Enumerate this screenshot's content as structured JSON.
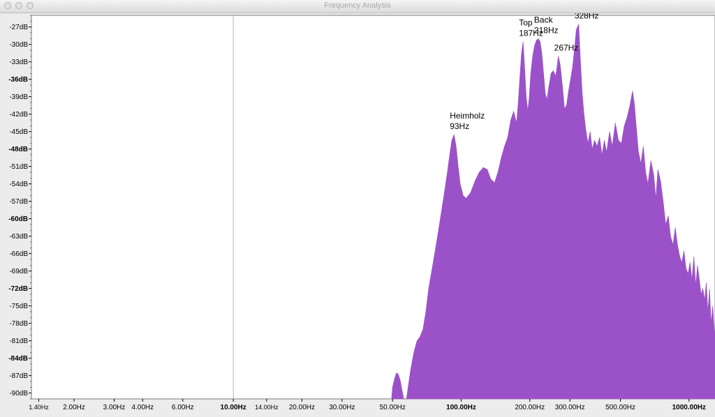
{
  "window": {
    "title": "Frequency Analysis"
  },
  "colors": {
    "spectrum_fill": "#9b52c9",
    "plot_background": "#ffffff",
    "window_background": "#ececec",
    "cursor_line": "#b4b4b4"
  },
  "chart_data": {
    "type": "area",
    "x_scale": "log",
    "y_unit": "dB",
    "xlim": [
      1.3,
      1300
    ],
    "ylim": [
      -91,
      -25
    ],
    "y_ticks": [
      {
        "value": -27,
        "label": "-27dB",
        "bold": false
      },
      {
        "value": -30,
        "label": "-30dB",
        "bold": false
      },
      {
        "value": -33,
        "label": "-33dB",
        "bold": false
      },
      {
        "value": -36,
        "label": "-36dB",
        "bold": true
      },
      {
        "value": -39,
        "label": "-39dB",
        "bold": false
      },
      {
        "value": -42,
        "label": "-42dB",
        "bold": false
      },
      {
        "value": -45,
        "label": "-45dB",
        "bold": false
      },
      {
        "value": -48,
        "label": "-48dB",
        "bold": true
      },
      {
        "value": -51,
        "label": "-51dB",
        "bold": false
      },
      {
        "value": -54,
        "label": "-54dB",
        "bold": false
      },
      {
        "value": -57,
        "label": "-57dB",
        "bold": false
      },
      {
        "value": -60,
        "label": "-60dB",
        "bold": true
      },
      {
        "value": -63,
        "label": "-63dB",
        "bold": false
      },
      {
        "value": -66,
        "label": "-66dB",
        "bold": false
      },
      {
        "value": -69,
        "label": "-69dB",
        "bold": false
      },
      {
        "value": -72,
        "label": "-72dB",
        "bold": true
      },
      {
        "value": -75,
        "label": "-75dB",
        "bold": false
      },
      {
        "value": -78,
        "label": "-78dB",
        "bold": false
      },
      {
        "value": -81,
        "label": "-81dB",
        "bold": false
      },
      {
        "value": -84,
        "label": "-84dB",
        "bold": true
      },
      {
        "value": -87,
        "label": "-87dB",
        "bold": false
      },
      {
        "value": -90,
        "label": "-90dB",
        "bold": false
      }
    ],
    "x_ticks": [
      {
        "value": 1.4,
        "label": "1.40Hz",
        "bold": false,
        "small": true
      },
      {
        "value": 2,
        "label": "2.00Hz",
        "bold": false,
        "small": false
      },
      {
        "value": 3,
        "label": "3.00Hz",
        "bold": false,
        "small": false
      },
      {
        "value": 4,
        "label": "4.00Hz",
        "bold": false,
        "small": false
      },
      {
        "value": 6,
        "label": "6.00Hz",
        "bold": false,
        "small": false
      },
      {
        "value": 10,
        "label": "10.00Hz",
        "bold": true,
        "small": false
      },
      {
        "value": 14,
        "label": "14.00Hz",
        "bold": false,
        "small": true
      },
      {
        "value": 20,
        "label": "20.00Hz",
        "bold": false,
        "small": false
      },
      {
        "value": 30,
        "label": "30.00Hz",
        "bold": false,
        "small": false
      },
      {
        "value": 50,
        "label": "50.00Hz",
        "bold": false,
        "small": false
      },
      {
        "value": 100,
        "label": "100.00Hz",
        "bold": true,
        "small": false
      },
      {
        "value": 200,
        "label": "200.00Hz",
        "bold": false,
        "small": false
      },
      {
        "value": 300,
        "label": "300.00Hz",
        "bold": false,
        "small": false
      },
      {
        "value": 500,
        "label": "500.00Hz",
        "bold": false,
        "small": false
      },
      {
        "value": 1000,
        "label": "1000.00Hz",
        "bold": true,
        "small": false
      }
    ],
    "cursor_x": 10,
    "spectrum": [
      [
        49.5,
        -91
      ],
      [
        50,
        -89
      ],
      [
        51,
        -87.5
      ],
      [
        52,
        -86.5
      ],
      [
        53,
        -86.8
      ],
      [
        54,
        -87.8
      ],
      [
        55,
        -89.5
      ],
      [
        56,
        -91
      ],
      [
        57.5,
        -91
      ],
      [
        58.5,
        -89
      ],
      [
        60,
        -86
      ],
      [
        62,
        -83
      ],
      [
        64,
        -81
      ],
      [
        66,
        -80.3
      ],
      [
        68,
        -79
      ],
      [
        70,
        -76
      ],
      [
        72,
        -72
      ],
      [
        75,
        -68
      ],
      [
        78,
        -64
      ],
      [
        81,
        -60
      ],
      [
        84,
        -56
      ],
      [
        87,
        -52
      ],
      [
        89,
        -49
      ],
      [
        91,
        -46.5
      ],
      [
        93,
        -45.5
      ],
      [
        95,
        -47.5
      ],
      [
        97,
        -51
      ],
      [
        99,
        -54
      ],
      [
        102,
        -56
      ],
      [
        105,
        -56.5
      ],
      [
        110,
        -55.5
      ],
      [
        115,
        -53.5
      ],
      [
        120,
        -52
      ],
      [
        125,
        -51.2
      ],
      [
        130,
        -51.5
      ],
      [
        135,
        -53.2
      ],
      [
        140,
        -53.8
      ],
      [
        145,
        -52
      ],
      [
        150,
        -49.5
      ],
      [
        155,
        -47.5
      ],
      [
        160,
        -46
      ],
      [
        165,
        -43
      ],
      [
        170,
        -41.5
      ],
      [
        175,
        -43.5
      ],
      [
        178,
        -40
      ],
      [
        181,
        -35.5
      ],
      [
        184,
        -31.5
      ],
      [
        187,
        -29.5
      ],
      [
        190,
        -34
      ],
      [
        193,
        -39
      ],
      [
        196,
        -41.5
      ],
      [
        199,
        -39
      ],
      [
        202,
        -35
      ],
      [
        206,
        -32
      ],
      [
        210,
        -30.2
      ],
      [
        214,
        -29.3
      ],
      [
        218,
        -29
      ],
      [
        222,
        -29.5
      ],
      [
        226,
        -31.5
      ],
      [
        230,
        -35
      ],
      [
        234,
        -38.5
      ],
      [
        238,
        -39.5
      ],
      [
        242,
        -37.5
      ],
      [
        248,
        -35
      ],
      [
        254,
        -34.5
      ],
      [
        260,
        -35.5
      ],
      [
        267,
        -32
      ],
      [
        272,
        -33.5
      ],
      [
        278,
        -37
      ],
      [
        284,
        -41
      ],
      [
        290,
        -40.5
      ],
      [
        296,
        -38
      ],
      [
        302,
        -36
      ],
      [
        308,
        -34
      ],
      [
        314,
        -31
      ],
      [
        320,
        -27.5
      ],
      [
        328,
        -26.5
      ],
      [
        334,
        -33
      ],
      [
        340,
        -38.5
      ],
      [
        346,
        -42
      ],
      [
        352,
        -44.5
      ],
      [
        360,
        -47
      ],
      [
        368,
        -45
      ],
      [
        376,
        -48
      ],
      [
        385,
        -46.5
      ],
      [
        395,
        -47.5
      ],
      [
        405,
        -46
      ],
      [
        415,
        -49
      ],
      [
        425,
        -46.5
      ],
      [
        435,
        -48.5
      ],
      [
        448,
        -45
      ],
      [
        460,
        -47.5
      ],
      [
        475,
        -43.5
      ],
      [
        490,
        -46.5
      ],
      [
        505,
        -47
      ],
      [
        520,
        -44
      ],
      [
        535,
        -42.5
      ],
      [
        550,
        -40.5
      ],
      [
        565,
        -38
      ],
      [
        575,
        -40
      ],
      [
        585,
        -43.5
      ],
      [
        600,
        -48.5
      ],
      [
        615,
        -50.5
      ],
      [
        630,
        -47.5
      ],
      [
        645,
        -52
      ],
      [
        660,
        -54
      ],
      [
        680,
        -50
      ],
      [
        700,
        -52.5
      ],
      [
        715,
        -56.5
      ],
      [
        730,
        -51.5
      ],
      [
        750,
        -53.5
      ],
      [
        770,
        -57
      ],
      [
        790,
        -61
      ],
      [
        810,
        -59.5
      ],
      [
        830,
        -63
      ],
      [
        850,
        -64.5
      ],
      [
        870,
        -61.5
      ],
      [
        890,
        -64.5
      ],
      [
        910,
        -66.5
      ],
      [
        930,
        -67.5
      ],
      [
        950,
        -65.5
      ],
      [
        970,
        -68.5
      ],
      [
        990,
        -69.5
      ],
      [
        1010,
        -67.5
      ],
      [
        1030,
        -70.5
      ],
      [
        1050,
        -66.5
      ],
      [
        1070,
        -71.5
      ],
      [
        1090,
        -68
      ],
      [
        1110,
        -70.5
      ],
      [
        1130,
        -73
      ],
      [
        1150,
        -72
      ],
      [
        1170,
        -74
      ],
      [
        1190,
        -71
      ],
      [
        1210,
        -76
      ],
      [
        1230,
        -72
      ],
      [
        1250,
        -78
      ],
      [
        1270,
        -75
      ],
      [
        1290,
        -79
      ],
      [
        1300,
        -80
      ]
    ],
    "annotations": [
      {
        "lines": [
          "Heimholz",
          "93Hz"
        ],
        "x": 93,
        "y": -45.5
      },
      {
        "lines": [
          "Top",
          "187Hz"
        ],
        "x": 187,
        "y": -29.5
      },
      {
        "lines": [
          "Back",
          "218Hz"
        ],
        "x": 218,
        "y": -29
      },
      {
        "lines": [
          "267Hz"
        ],
        "x": 267,
        "y": -32
      },
      {
        "lines": [
          "328Hz"
        ],
        "x": 328,
        "y": -26.5
      }
    ]
  }
}
